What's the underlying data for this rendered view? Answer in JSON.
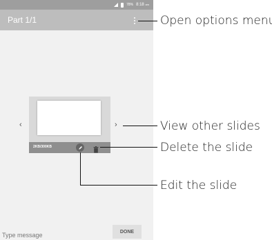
{
  "status_bar": {
    "battery_percent": "78%",
    "time": "8:18",
    "ampm": "am"
  },
  "app_bar": {
    "title": "Part 1/1",
    "menu_icon": "more-vert-icon"
  },
  "slide": {
    "size": "2KB/300KB",
    "prev_icon": "chevron-left-icon",
    "next_icon": "chevron-right-icon",
    "edit_icon": "pencil-icon",
    "delete_icon": "trash-icon"
  },
  "composer": {
    "placeholder": "Type message",
    "done_label": "DONE"
  },
  "callouts": {
    "menu": "Open options menu",
    "other_slides": "View other slides",
    "delete": "Delete the slide",
    "edit": "Edit the slide"
  }
}
